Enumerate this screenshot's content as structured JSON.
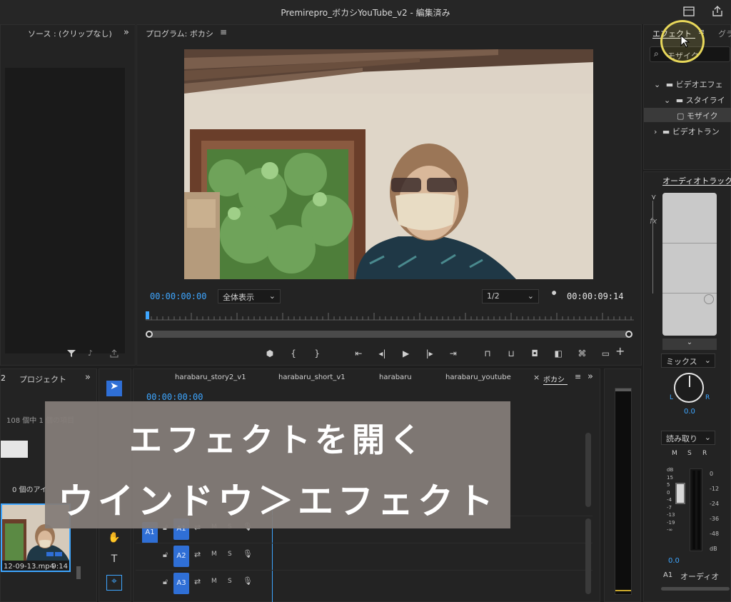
{
  "window": {
    "title": "Premirepro_ボカシYouTube_v2 - 編集済み"
  },
  "source_panel": {
    "title": "ソース : (クリップなし)",
    "menu_glyph": "»"
  },
  "program_panel": {
    "title": "プログラム: ボカシ",
    "menu_glyph": "≡",
    "timecode_in": "00:00:00:00",
    "fit": "全体表示",
    "resolution": "1/2",
    "timecode_dur": "00:00:09:14"
  },
  "effects_panel": {
    "tab_effects": "エフェクト",
    "tab_menu": "≡",
    "tab_next": "グラ",
    "search_value": "モザイク",
    "tree": [
      {
        "label": "ビデオエフェ",
        "indent": 0,
        "open": true,
        "kind": "folder"
      },
      {
        "label": "スタイライ",
        "indent": 1,
        "open": true,
        "kind": "folder"
      },
      {
        "label": "モザイク",
        "indent": 2,
        "open": false,
        "kind": "effect",
        "selected": true
      },
      {
        "label": "ビデオトラン",
        "indent": 0,
        "open": false,
        "kind": "folder"
      }
    ]
  },
  "audio_mixer": {
    "title": "オーディオトラック",
    "mix_label": "ミックス",
    "pan_value": "0.0",
    "pan_L": "L",
    "pan_R": "R",
    "read_label": "読み取り",
    "msr": [
      "M",
      "S",
      "R"
    ],
    "db_left": [
      "dB",
      "15",
      "5",
      "0",
      "-4",
      "-7",
      "-13",
      "-19",
      "-∞"
    ],
    "db_right": [
      "0",
      "-12",
      "-24",
      "-36",
      "-48",
      "dB"
    ],
    "fader_value": "0.0",
    "channel": "A1",
    "channel_name": "オーディオ",
    "fx_label": "fx"
  },
  "project_panel": {
    "tab_left": "2",
    "tab_title": "プロジェクト",
    "menu_glyph": "»",
    "count_text": "108 個中 1 個の項目",
    "audio_text": "0 個のアイ",
    "clip_name": "12-09-13.mp4",
    "clip_duration": "9:14"
  },
  "timeline": {
    "tabs": [
      "harabaru_story2_v1",
      "harabaru_short_v1",
      "harabaru",
      "harabaru_youtube",
      "ボカシ"
    ],
    "active_tab_menu": "≡",
    "close_glyph": "×",
    "more_glyph": "»",
    "timecode": "00:00:00:00",
    "audio_tracks": [
      {
        "name": "A1",
        "m": "M",
        "s": "S"
      },
      {
        "name": "A2",
        "m": "M",
        "s": "S"
      },
      {
        "name": "A3",
        "m": "M",
        "s": "S"
      }
    ],
    "left_label": "A1"
  },
  "caption": {
    "line1": "エフェクトを開く",
    "line2": "ウインドウ＞エフェクト"
  },
  "colors": {
    "accent": "#3ea6ff",
    "track_blue": "#2f6fd6",
    "cursor_ring": "#e7d75a"
  }
}
